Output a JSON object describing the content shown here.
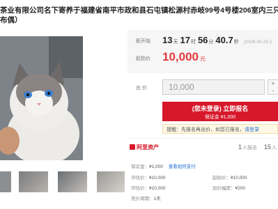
{
  "title": {
    "line1": "茶业有限公司名下寄养于福建省南平市政和县石屯镇松源村赤岐99号4号楼206室内三只大猫（两",
    "line2": "布偶）"
  },
  "countdown": {
    "label": "距开始",
    "days": "13",
    "days_unit": "天",
    "hours": "17",
    "hours_unit": "时",
    "minutes": "56",
    "minutes_unit": "分",
    "seconds": "40.7",
    "seconds_unit": "秒",
    "start_time": "(2026-05-25 1"
  },
  "start_price": {
    "label": "起拍价",
    "value": "10,000",
    "currency": "元"
  },
  "bid": {
    "label": "出 价",
    "value": "10,000",
    "plus": "+",
    "minus": "-"
  },
  "apply_button": {
    "line1": "(您未登录) 立即报名",
    "line2": "保证金 ¥1,000"
  },
  "tip": {
    "text": "提醒：先报名再出价，如您已报名，",
    "link": "请登录"
  },
  "platform": {
    "logo": "阿里资产"
  },
  "stats": {
    "count1": "1",
    "unit1": "人报名",
    "count2": "15",
    "unit2": "人"
  },
  "info": [
    {
      "k": "保证金：",
      "v": "¥1,000",
      "link": "查看如何支付"
    },
    {
      "k": "评估价：",
      "v": "¥10,000"
    },
    {
      "k": "起拍价：",
      "v": "¥10,000"
    },
    {
      "k": "评估价：",
      "v": "¥10,000"
    },
    {
      "k": "加价幅度：",
      "v": "¥200"
    },
    {
      "k": "竞价周期：",
      "v": "1天"
    }
  ],
  "colors": {
    "accent": "#d7182a",
    "link": "#1f6bd1"
  }
}
